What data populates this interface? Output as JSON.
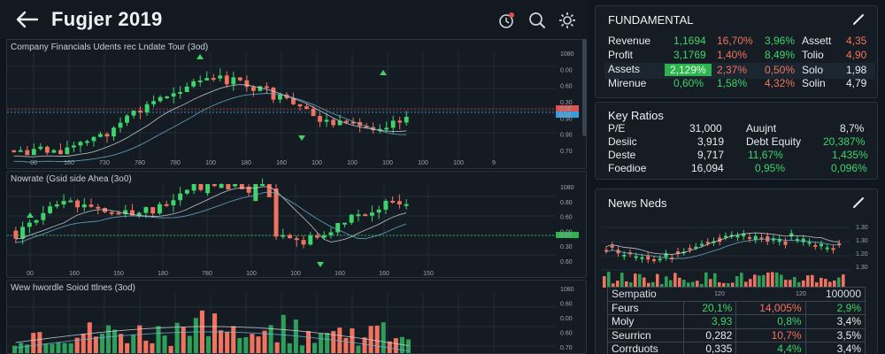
{
  "header": {
    "title": "Fugjer 2019",
    "icons": [
      "back-arrow-icon",
      "alarm-clock-icon",
      "search-icon",
      "settings-gear-icon"
    ]
  },
  "panels": [
    {
      "title": "Company Financials Udents rec Lndate Tour (3od)",
      "x_ticks": [
        "00",
        "160",
        "730",
        "780",
        "780",
        "100",
        "180",
        "160",
        "100",
        "100",
        "100",
        "100",
        "100",
        "9"
      ],
      "y_ticks": [
        "1080",
        "0.00",
        "0.60",
        "0.30",
        "0.90",
        "0.90",
        "0.70"
      ],
      "price_tags": [
        "0.00",
        "0.10"
      ]
    },
    {
      "title": "Nowrate (Gsid side Ahea (3o0)",
      "x_ticks": [
        "00",
        "160",
        "150",
        "180",
        "780",
        "100",
        "100",
        "160",
        "160",
        "150"
      ],
      "y_ticks": [
        "1080",
        "0.80",
        "0.60",
        "0.00",
        "0.30",
        "0.60"
      ],
      "price_tags": [
        "0.00"
      ]
    },
    {
      "title": "Wew hwordle Soiod ttlnes (3od)",
      "y_ticks": [
        "1080",
        "0.60",
        "0.00",
        "0.60",
        "0.70"
      ]
    }
  ],
  "fundamental": {
    "title": "FUNDAMENTAL",
    "rows": [
      {
        "label": "Revenue",
        "v1": "1,1694",
        "v2": "16,70%",
        "v3": "3,96%",
        "k": "Assett",
        "v4": "4,35"
      },
      {
        "label": "Profit",
        "v1": "3,1769",
        "v2": "1,40%",
        "v3": "8,49%",
        "k": "Tolio",
        "v4": "4,90"
      },
      {
        "label": "Assets",
        "v1": "2,129%",
        "v2": "2,37%",
        "v3": "0,50%",
        "k": "Solo",
        "v4": "1,98"
      },
      {
        "label": "Mirenue",
        "v1": "0,60%",
        "v2": "1,58%",
        "v3": "4,32%",
        "k": "Solin",
        "v4": "4,79"
      }
    ]
  },
  "key_ratios": {
    "title": "Key Ratios",
    "rows": [
      {
        "label": "P/E",
        "v1": "31,000",
        "k": "Auujnt",
        "v2": "8,7%"
      },
      {
        "label": "Desiic",
        "v1": "3,919",
        "k": "Debt Equity",
        "v2": "20,387%"
      },
      {
        "label": "Deste",
        "v1": "9,717",
        "k": "11,67%",
        "v2": "1,435%"
      },
      {
        "label": "Foedioe",
        "v1": "16,094",
        "k": "0,95%",
        "v2": "0,096%"
      }
    ]
  },
  "news": {
    "title": "News Neds",
    "y_ticks": [
      "1.30",
      "1.30",
      "1.20",
      "1.30"
    ],
    "x_ticks": [
      "120",
      "120",
      "120"
    ]
  },
  "summary": {
    "header": {
      "label": "Sempatio",
      "value": "100000"
    },
    "rows": [
      {
        "label": "Feurs",
        "v1": "20,1%",
        "v2": "14,005%",
        "v3": "2,9%"
      },
      {
        "label": "Moly",
        "v1": "3,93",
        "v2": "0,8%",
        "v3": "3,4%"
      },
      {
        "label": "Seurricn",
        "v1": "0,282",
        "v2": "10,7%",
        "v3": "3,5%"
      },
      {
        "label": "Corrduots",
        "v1": "0,335",
        "v2": "4,4%",
        "v3": "3,4%"
      }
    ]
  },
  "colors": {
    "up": "#3fd36b",
    "down": "#f0735f",
    "bg": "#10161d",
    "panel": "#141b22"
  }
}
